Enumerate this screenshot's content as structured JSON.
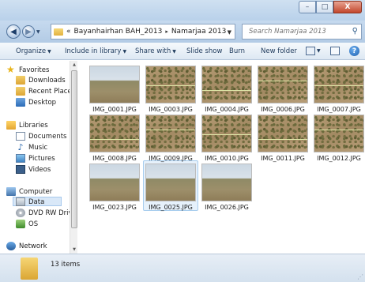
{
  "window": {
    "minimize_glyph": "–",
    "maximize_glyph": "□",
    "close_glyph": "X"
  },
  "address": {
    "overflow": "«",
    "crumbs": [
      "Bayanhairhan BAH_2013",
      "Namarjaa 2013"
    ],
    "separator": "▸"
  },
  "search": {
    "placeholder": "Search Namarjaa 2013"
  },
  "toolbar": {
    "organize": "Organize",
    "include_in_library": "Include in library",
    "share_with": "Share with",
    "slide_show": "Slide show",
    "burn": "Burn",
    "new_folder": "New folder",
    "help_glyph": "?"
  },
  "nav": {
    "favorites": "Favorites",
    "downloads": "Downloads",
    "recent_places": "Recent Place",
    "desktop": "Desktop",
    "libraries": "Libraries",
    "documents": "Documents",
    "music": "Music",
    "pictures": "Pictures",
    "videos": "Videos",
    "computer": "Computer",
    "data": "Data",
    "dvd": "DVD RW Driv",
    "os": "OS",
    "network": "Network"
  },
  "files": [
    {
      "name": "IMG_0001.JPG",
      "kind": "landscape"
    },
    {
      "name": "IMG_0003.JPG",
      "kind": "ground"
    },
    {
      "name": "IMG_0004.JPG",
      "kind": "ground"
    },
    {
      "name": "IMG_0006.JPG",
      "kind": "ground"
    },
    {
      "name": "IMG_0007.JPG",
      "kind": "ground"
    },
    {
      "name": "IMG_0008.JPG",
      "kind": "ground"
    },
    {
      "name": "IMG_0009.JPG",
      "kind": "ground"
    },
    {
      "name": "IMG_0010.JPG",
      "kind": "ground"
    },
    {
      "name": "IMG_0011.JPG",
      "kind": "ground"
    },
    {
      "name": "IMG_0012.JPG",
      "kind": "ground"
    },
    {
      "name": "IMG_0023.JPG",
      "kind": "landscape"
    },
    {
      "name": "IMG_0025.JPG",
      "kind": "landscape",
      "selected": true
    },
    {
      "name": "IMG_0026.JPG",
      "kind": "landscape"
    }
  ],
  "status": {
    "item_count": "13 items"
  },
  "colors": {
    "titlebar": "#cfe0f1",
    "close_button": "#c2462c",
    "selection": "#e6f1fb"
  }
}
